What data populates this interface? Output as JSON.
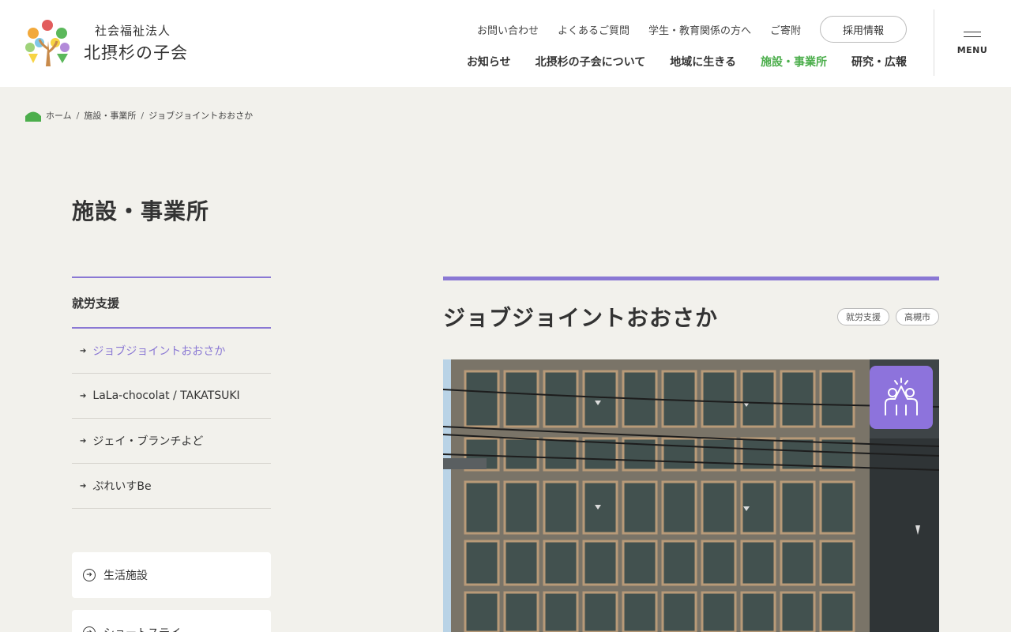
{
  "header": {
    "logo_sub": "社会福祉法人",
    "logo_main": "北摂杉の子会",
    "util_links": [
      "お問い合わせ",
      "よくあるご質問",
      "学生・教育関係の方へ",
      "ご寄附"
    ],
    "recruit_label": "採用情報",
    "main_nav": [
      "お知らせ",
      "北摂杉の子会について",
      "地域に生きる",
      "施設・事業所",
      "研究・広報"
    ],
    "active_nav": "施設・事業所",
    "menu_label": "MENU"
  },
  "breadcrumb": [
    "ホーム",
    "施設・事業所",
    "ジョブジョイントおおさか"
  ],
  "page_title": "施設・事業所",
  "sidebar": {
    "category": "就労支援",
    "items": [
      "ジョブジョイントおおさか",
      "LaLa-chocolat / TAKATSUKI",
      "ジェイ・ブランチよど",
      "ぷれいすBe"
    ],
    "current_item": "ジョブジョイントおおさか",
    "cards": [
      "生活施設",
      "ショートステイ"
    ]
  },
  "main": {
    "title": "ジョブジョイントおおさか",
    "tags": [
      "就労支援",
      "高槻市"
    ],
    "photo_icon": "high-five-icon"
  },
  "colors": {
    "accent_purple": "#8a78d4",
    "active_green": "#4cae4c",
    "background": "#f2f1ec",
    "icon_badge": "#8d73dc"
  }
}
